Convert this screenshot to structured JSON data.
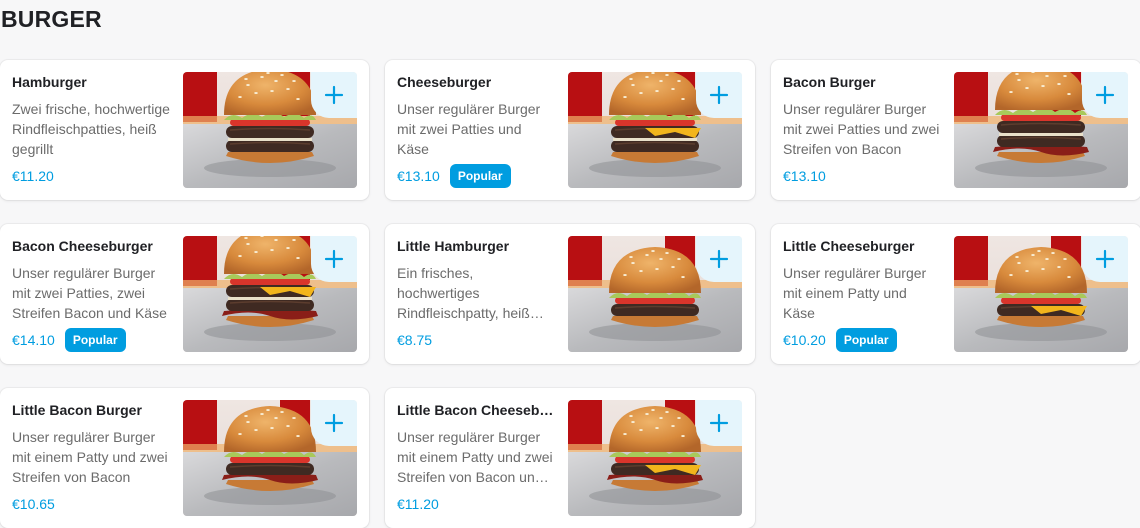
{
  "section": {
    "title": "BURGER"
  },
  "colors": {
    "accent": "#009de0",
    "accent_bg": "#e5f5fc"
  },
  "add_icon": "plus-icon",
  "items": [
    {
      "name": "Hamburger",
      "description": "Zwei frische, hochwertige Rindfleischpatties, heiß gegrillt",
      "price": "€11.20",
      "badge": "",
      "cheese": false,
      "bacon": false,
      "patties": 2
    },
    {
      "name": "Cheeseburger",
      "description": "Unser regulärer Burger mit zwei Patties und Käse",
      "price": "€13.10",
      "badge": "Popular",
      "cheese": true,
      "bacon": false,
      "patties": 2
    },
    {
      "name": "Bacon Burger",
      "description": "Unser regulärer Burger mit zwei Patties und zwei Streifen von Bacon",
      "price": "€13.10",
      "badge": "",
      "cheese": false,
      "bacon": true,
      "patties": 2
    },
    {
      "name": "Bacon Cheeseburger",
      "description": "Unser regulärer Burger mit zwei Patties, zwei Streifen Bacon und Käse",
      "price": "€14.10",
      "badge": "Popular",
      "cheese": true,
      "bacon": true,
      "patties": 2
    },
    {
      "name": "Little Hamburger",
      "description": "Ein frisches, hochwertiges Rindfleischpatty, heiß gegrillt",
      "price": "€8.75",
      "badge": "",
      "cheese": false,
      "bacon": false,
      "patties": 1
    },
    {
      "name": "Little Cheeseburger",
      "description": "Unser regulärer Burger mit einem Patty und Käse",
      "price": "€10.20",
      "badge": "Popular",
      "cheese": true,
      "bacon": false,
      "patties": 1
    },
    {
      "name": "Little Bacon Burger",
      "description": "Unser regulärer Burger mit einem Patty und zwei Streifen von Bacon",
      "price": "€10.65",
      "badge": "",
      "cheese": false,
      "bacon": true,
      "patties": 1
    },
    {
      "name": "Little Bacon Cheeseburger",
      "description": "Unser regulärer Burger mit einem Patty und zwei Streifen von Bacon und Käse",
      "price": "€11.20",
      "badge": "",
      "cheese": true,
      "bacon": true,
      "patties": 1
    }
  ]
}
